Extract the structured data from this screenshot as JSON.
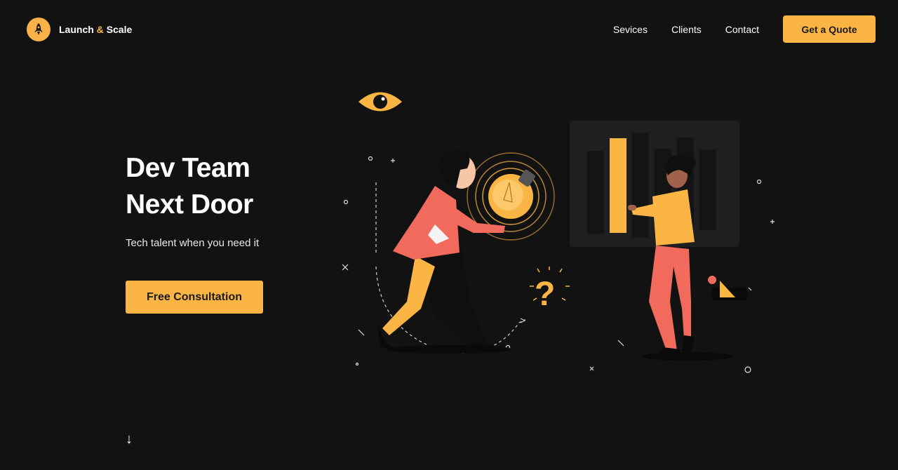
{
  "brand": {
    "name_part1": "Launch",
    "amp": "&",
    "name_part2": "Scale",
    "icon": "rocket-icon"
  },
  "nav": {
    "items": [
      {
        "label": "Sevices"
      },
      {
        "label": "Clients"
      },
      {
        "label": "Contact"
      }
    ],
    "cta_label": "Get a Quote"
  },
  "hero": {
    "title_line1": "Dev Team",
    "title_line2": "Next Door",
    "subtitle": "Tech talent when you need it",
    "cta_label": "Free Consultation"
  },
  "scroll": {
    "icon": "arrow-down-icon",
    "glyph": "↓"
  },
  "colors": {
    "background": "#121212",
    "accent": "#fbb545",
    "coral": "#f16a5b",
    "text": "#ffffff"
  }
}
